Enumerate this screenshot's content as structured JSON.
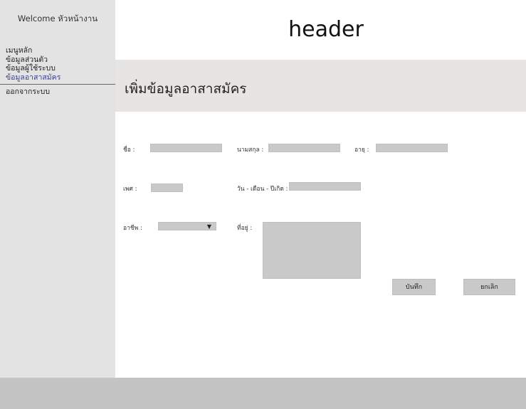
{
  "sidebar": {
    "welcome": "Welcome หัวหน้างาน",
    "items": [
      {
        "label": "เมนูหลัก"
      },
      {
        "label": "ข้อมูลส่วนตัว"
      },
      {
        "label": "ข้อมูลผู้ใช้ระบบ"
      },
      {
        "label": "ข้อมูลอาสาสมัคร",
        "active": true
      },
      {
        "label": "ออกจากระบบ"
      }
    ]
  },
  "header": {
    "title": "header"
  },
  "page": {
    "title": "เพิ่มข้อมูลอาสาสมัคร"
  },
  "form": {
    "first_name_label": "ชื่อ :",
    "first_name_value": "",
    "last_name_label": "นามสกุล :",
    "last_name_value": "",
    "age_label": "อายุ :",
    "age_value": "",
    "gender_label": "เพศ :",
    "gender_value": "",
    "birthdate_label": "วัน - เดือน - ปีเกิด :",
    "birthdate_value": "",
    "occupation_label": "อาชีพ :",
    "occupation_selected": "",
    "address_label": "ที่อยู่ :",
    "address_value": ""
  },
  "actions": {
    "save_label": "บันทึก",
    "cancel_label": "ยกเลิก"
  },
  "icons": {
    "dropdown": "chevron-down-icon"
  },
  "colors": {
    "sidebar_bg": "#e3e3e3",
    "titlebar_bg": "#e7e5e3",
    "field_bg": "#c9c9c9",
    "footer_bg": "#c4c4c4",
    "active_menu": "#3b3f8f"
  }
}
